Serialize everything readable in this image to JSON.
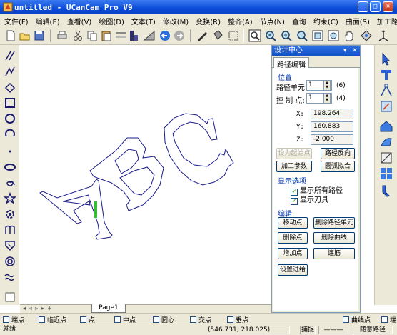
{
  "window": {
    "title": "untitled - UCanCam Pro V9",
    "minimize": "_",
    "maximize": "□",
    "close": "✕"
  },
  "menu": [
    "文件(F)",
    "编辑(E)",
    "查看(V)",
    "绘图(D)",
    "文本(T)",
    "修改(M)",
    "变换(R)",
    "整齐(A)",
    "节点(N)",
    "查询",
    "约束(C)",
    "曲面(S)",
    "加工路径(K)"
  ],
  "toolbar_icons": [
    "new-icon",
    "open-icon",
    "save-icon",
    "print-icon",
    "cut-icon",
    "copy-icon",
    "paste-icon",
    "layer-icon",
    "ruler-icon",
    "chart-icon",
    "undo-icon",
    "redo-icon",
    "pen-icon",
    "bucket-icon",
    "select-icon",
    "zoom-in-icon",
    "zoom-out-icon",
    "zoom-fit-icon",
    "zoom-window-icon",
    "zoom-page-icon",
    "pan-hand-icon",
    "rotate-view-icon",
    "axis-icon"
  ],
  "left_tools": [
    "line-tool-icon",
    "polyline-tool-icon",
    "curve-tool-icon",
    "rectangle-tool-icon",
    "circle-tool-icon",
    "arc-tool-icon",
    "point-tool-icon",
    "ellipse-tool-icon",
    "spiral-tool-icon",
    "star-tool-icon",
    "gear-tool-icon",
    "bezier-tool-icon",
    "polygon-tool-icon",
    "target-tool-icon",
    "wave-tool-icon",
    "grid-tool-icon"
  ],
  "right_tools": [
    "arrow-select-icon",
    "text-tool-icon",
    "node-edit-icon",
    "transform-icon",
    "house-icon",
    "shape-icon",
    "mesh-icon",
    "grid4-icon",
    "measure-icon",
    "knife-tool-icon"
  ],
  "canvas": {
    "text": "ABC"
  },
  "tabs": {
    "page": "Page1",
    "nav": "◂ ◃ ▹ ▸ +"
  },
  "snap": [
    "端点",
    "临近点",
    "点",
    "中点",
    "圆心",
    "交点",
    "垂点",
    "",
    "曲线点",
    "端"
  ],
  "status": {
    "state": "就绪",
    "coords": "(546.731,  218.025)",
    "capture": "捕捉",
    "line_style": "———",
    "mode": "随意路径"
  },
  "panel": {
    "title": "设计中心",
    "pin": "▾",
    "close": "✕",
    "tab": "路径编辑",
    "position": {
      "label": "位置",
      "unit_label": "路径单元:",
      "unit_value": "1",
      "unit_count": "(6)",
      "point_label": "控 制 点:",
      "point_value": "1",
      "point_count": "(4)",
      "x_label": "X:",
      "x_value": "198.264",
      "y_label": "Y:",
      "y_value": "160.883",
      "z_label": "Z:",
      "z_value": "-2.000"
    },
    "buttons": {
      "set_start": "设为起始点",
      "reverse": "路径反向",
      "params": "加工参数",
      "arc_fit": "圆弧拟合"
    },
    "display": {
      "label": "显示选项",
      "show_all": "显示所有路径",
      "show_tool": "显示刀具",
      "show_all_checked": true,
      "show_tool_checked": true
    },
    "edit": {
      "label": "编辑",
      "move_point": "移动点",
      "delete_unit": "删除路径单元",
      "delete_point": "删除点",
      "delete_curve": "删除曲线",
      "add_point": "增加点",
      "connect": "连筋",
      "set_entry": "设置进给"
    }
  },
  "colors": {
    "title_bar": "#0a4bd8",
    "chrome": "#ece9d8",
    "curve": "#1a1a8c",
    "tool_marker": "#2fbf2f",
    "section_label": "#0033aa"
  }
}
